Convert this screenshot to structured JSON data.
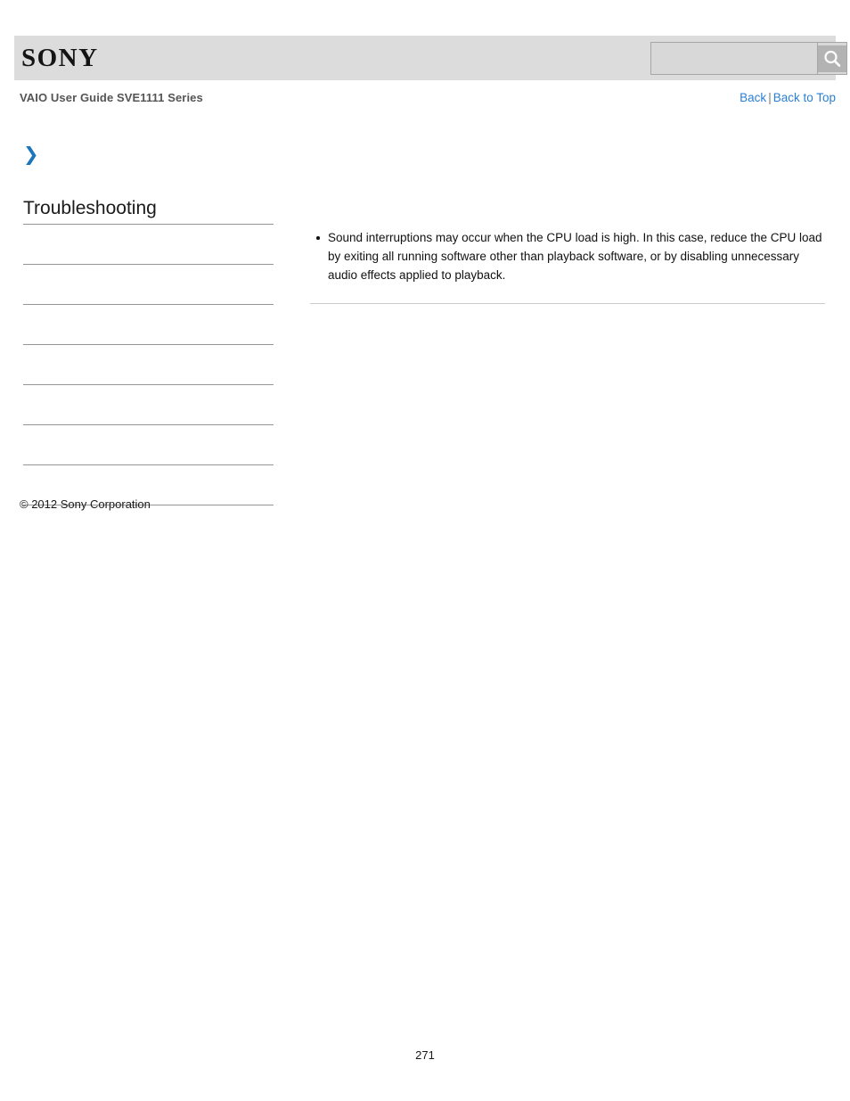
{
  "header": {
    "logo_text": "SONY",
    "search": {
      "value": "",
      "placeholder": "",
      "button_icon": "search-icon",
      "button_label": ""
    }
  },
  "subheader": {
    "guide_title": "VAIO User Guide SVE1111 Series",
    "nav": {
      "back_label": "Back",
      "separator": "|",
      "back_to_top_label": "Back to Top"
    }
  },
  "marker": {
    "icon": "double-chevron-right-icon",
    "glyph": "❯"
  },
  "sidebar": {
    "heading": "Troubleshooting",
    "items": [
      {
        "label": ""
      },
      {
        "label": ""
      },
      {
        "label": ""
      },
      {
        "label": ""
      },
      {
        "label": ""
      },
      {
        "label": ""
      },
      {
        "label": ""
      }
    ]
  },
  "main": {
    "bullets": [
      "Sound interruptions may occur when the CPU load is high. In this case, reduce the CPU load by exiting all running software other than playback software, or by disabling unnecessary audio effects applied to playback."
    ]
  },
  "footer": {
    "copyright": "© 2012 Sony Corporation",
    "page_number": "271"
  },
  "colors": {
    "header_bg": "#dcdcdc",
    "link_blue": "#2a7fd4",
    "chevron_blue": "#1b75bb",
    "rule_gray": "#959595",
    "content_rule_gray": "#cccccc",
    "guide_title_gray": "#555555"
  }
}
